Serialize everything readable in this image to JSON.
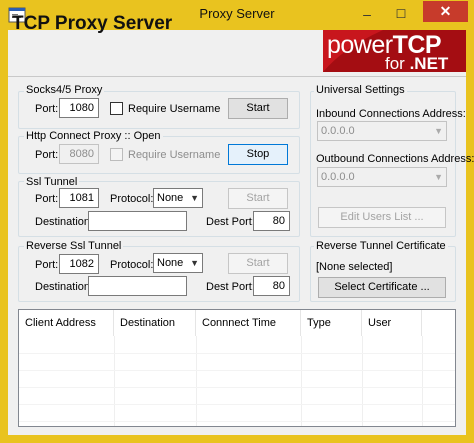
{
  "window": {
    "title": "Proxy Server",
    "minimize_icon": "minimize-icon",
    "maximize_icon": "maximize-icon",
    "close_icon": "close-icon",
    "minimize_glyph": "–",
    "maximize_glyph": "☐",
    "close_glyph": "✕"
  },
  "header": {
    "title": "TCP Proxy Server",
    "logo_power": "power",
    "logo_tcp": "TCP",
    "logo_for": "for ",
    "logo_net": ".NET"
  },
  "socks": {
    "legend": "Socks4/5 Proxy",
    "port_label": "Port:",
    "port_value": "1080",
    "require_username_label": "Require Username",
    "require_username_checked": false,
    "start_label": "Start"
  },
  "http_connect": {
    "legend": "Http Connect Proxy :: Open",
    "port_label": "Port:",
    "port_value": "8080",
    "require_username_label": "Require Username",
    "stop_label": "Stop"
  },
  "ssl_tunnel": {
    "legend": "Ssl Tunnel",
    "port_label": "Port:",
    "port_value": "1081",
    "protocol_label": "Protocol:",
    "protocol_value": "None",
    "start_label": "Start",
    "destination_label": "Destination:",
    "destination_value": "",
    "dest_port_label": "Dest Port:",
    "dest_port_value": "80"
  },
  "reverse_ssl_tunnel": {
    "legend": "Reverse Ssl Tunnel",
    "port_label": "Port:",
    "port_value": "1082",
    "protocol_label": "Protocol:",
    "protocol_value": "None",
    "start_label": "Start",
    "destination_label": "Destination:",
    "destination_value": "",
    "dest_port_label": "Dest Port:",
    "dest_port_value": "80"
  },
  "universal_settings": {
    "legend": "Universal Settings",
    "inbound_label": "Inbound Connections Address:",
    "inbound_value": "0.0.0.0",
    "outbound_label": "Outbound Connections Address:",
    "outbound_value": "0.0.0.0",
    "edit_users_label": "Edit Users List ..."
  },
  "reverse_cert": {
    "legend": "Reverse Tunnel Certificate",
    "status": "[None selected]",
    "select_label": "Select Certificate ..."
  },
  "connections": {
    "columns": [
      "Client Address",
      "Destination",
      "Connnect Time",
      "Type",
      "User"
    ],
    "rows": []
  },
  "colors": {
    "window_frame": "#e9c31f",
    "close_button": "#c73b2b",
    "logo_background": "#a40d12"
  }
}
